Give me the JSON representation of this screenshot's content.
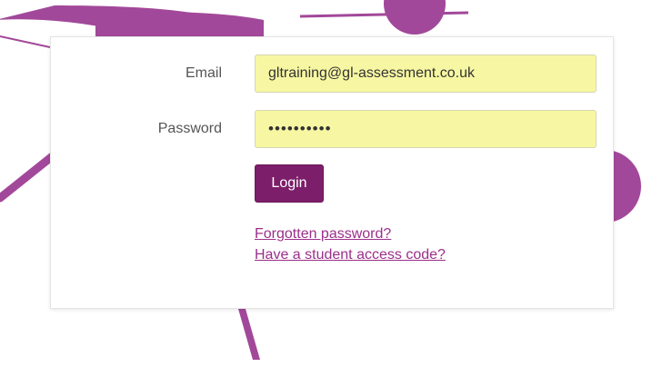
{
  "theme": {
    "accent": "#7d1e6a",
    "link": "#9b2f8a",
    "decor": "#a2489a",
    "field_fill": "#f7f7a3"
  },
  "form": {
    "email_label": "Email",
    "email_value": "gltraining@gl-assessment.co.uk",
    "password_label": "Password",
    "password_value": "••••••••••",
    "login_label": "Login",
    "forgot_link": "Forgotten password?",
    "student_code_link": "Have a student access code?"
  }
}
